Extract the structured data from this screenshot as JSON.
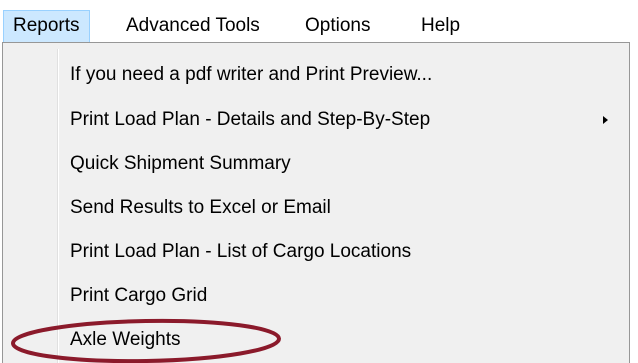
{
  "menubar": {
    "items": [
      {
        "label": "Reports",
        "active": true
      },
      {
        "label": "Advanced Tools",
        "active": false
      },
      {
        "label": "Options",
        "active": false
      },
      {
        "label": "Help",
        "active": false
      }
    ]
  },
  "reports_menu": {
    "items": [
      {
        "label": "If you need a pdf writer and Print Preview...",
        "has_submenu": false
      },
      {
        "label": "Print Load Plan - Details and Step-By-Step",
        "has_submenu": true
      },
      {
        "label": "Quick Shipment Summary",
        "has_submenu": false
      },
      {
        "label": "Send Results to Excel or Email",
        "has_submenu": false
      },
      {
        "label": "Print Load Plan - List of Cargo Locations",
        "has_submenu": false
      },
      {
        "label": "Print Cargo Grid",
        "has_submenu": false
      },
      {
        "label": "Axle Weights",
        "has_submenu": false,
        "circled": true
      }
    ]
  },
  "colors": {
    "menu_background": "#f0f0f0",
    "active_menubar_background": "#cce8ff",
    "active_menubar_border": "#99d1ff",
    "annotation_ellipse": "#8b1a2b"
  },
  "icons": {
    "submenu": "chevron-right-icon"
  }
}
